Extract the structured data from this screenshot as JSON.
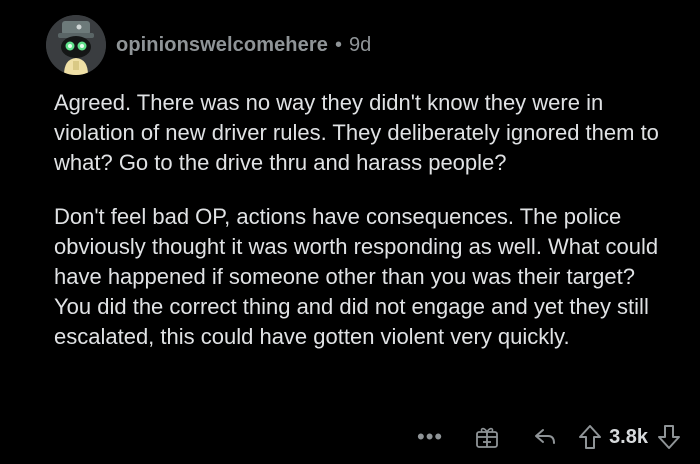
{
  "comment": {
    "author": "opinionswelcomehere",
    "separator": "•",
    "age": "9d",
    "paragraphs": [
      "Agreed.  There was no way they didn't know they were in violation of new driver rules. They deliberately ignored them to what? Go to the drive thru and harass people?",
      "Don't feel bad OP, actions have consequences. The police obviously thought it was worth responding as well. What could have happened if someone other than you was their target? You did the correct thing and did not engage and yet they still escalated, this could have gotten violent very quickly."
    ],
    "actions": {
      "more_label": "•••",
      "score": "3.8k"
    }
  },
  "icons": {
    "avatar": "snoo-avatar-icon",
    "award": "gift-award-icon",
    "reply": "reply-arrow-icon",
    "upvote": "upvote-arrow-icon",
    "downvote": "downvote-arrow-icon"
  },
  "colors": {
    "background": "#000000",
    "text": "#e0e2e4",
    "meta": "#8f9497",
    "avatar_bg": "#3a3d40"
  }
}
